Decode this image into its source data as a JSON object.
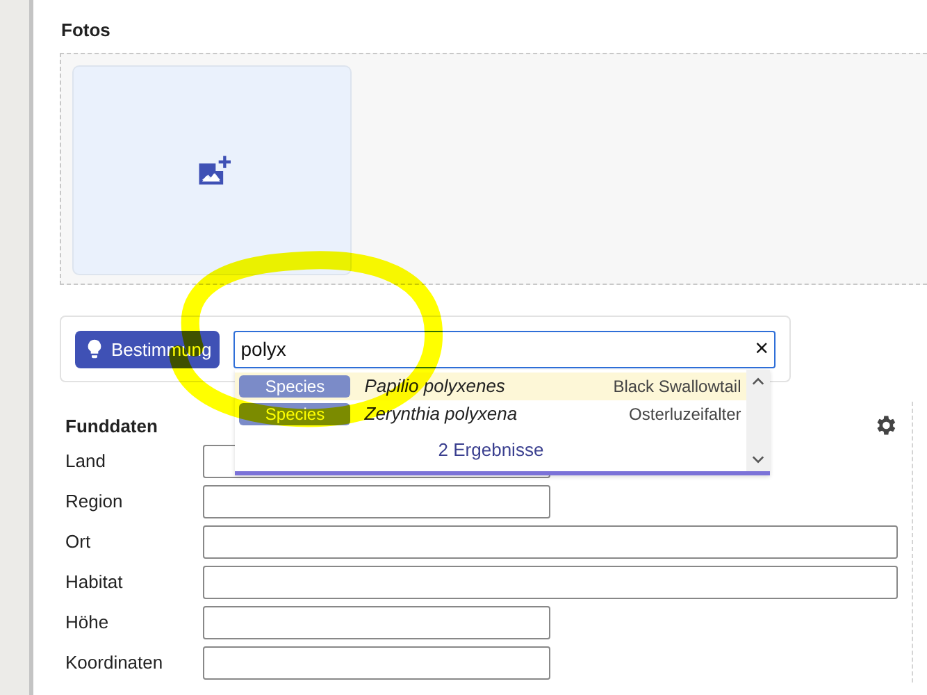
{
  "photos": {
    "title": "Fotos"
  },
  "identify": {
    "button": "Bestimmung",
    "query": "polyx",
    "clear": "×",
    "results": [
      {
        "tag": "Species",
        "name": "Papilio polyxenes",
        "common": "Black Swallowtail",
        "selected": true
      },
      {
        "tag": "Species",
        "name": "Zerynthia polyxena",
        "common": "Osterluzeifalter",
        "selected": false
      }
    ],
    "count": "2 Ergebnisse"
  },
  "find_data": {
    "title": "Funddaten",
    "fields": [
      {
        "label": "Land",
        "kind": "short"
      },
      {
        "label": "Region",
        "kind": "short"
      },
      {
        "label": "Ort",
        "kind": "long"
      },
      {
        "label": "Habitat",
        "kind": "long"
      },
      {
        "label": "Höhe",
        "kind": "short"
      },
      {
        "label": "Koordinaten",
        "kind": "short"
      }
    ]
  },
  "annotation": {
    "kind": "circle"
  }
}
